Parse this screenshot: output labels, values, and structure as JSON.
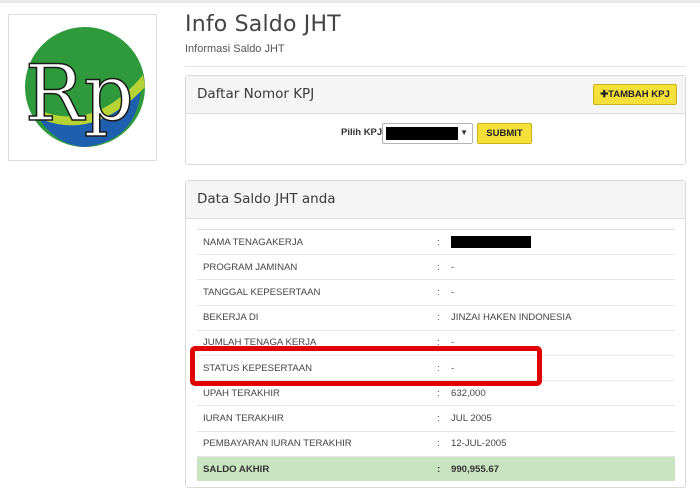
{
  "header": {
    "title": "Info Saldo JHT",
    "subtitle": "Informasi Saldo JHT"
  },
  "logo": {
    "text": "Rp",
    "icon": "rupiah-logo-icon",
    "colors": {
      "green": "#2e9a3c",
      "lime": "#b5d334",
      "blue": "#1f5fb0"
    }
  },
  "kpj_panel": {
    "title": "Daftar Nomor KPJ",
    "add_button": "✚TAMBAH KPJ",
    "select_label": "Pilih KPJ",
    "submit_button": "SUBMIT"
  },
  "saldo_panel": {
    "title": "Data Saldo JHT anda",
    "separator": ":",
    "rows": [
      {
        "label": "NAMA TENAGAKERJA",
        "value": ""
      },
      {
        "label": "PROGRAM JAMINAN",
        "value": "-"
      },
      {
        "label": "TANGGAL KEPESERTAAN",
        "value": "-"
      },
      {
        "label": "BEKERJA DI",
        "value": "JINZAI HAKEN INDONESIA"
      },
      {
        "label": "JUMLAH TENAGA KERJA",
        "value": "-"
      },
      {
        "label": "STATUS KEPESERTAAN",
        "value": "-"
      },
      {
        "label": "UPAH TERAKHIR",
        "value": "632,000"
      },
      {
        "label": "IURAN TERAKHIR",
        "value": "JUL 2005"
      },
      {
        "label": "PEMBAYARAN IURAN TERAKHIR",
        "value": "12-JUL-2005"
      },
      {
        "label": "SALDO AKHIR",
        "value": "990,955.67"
      }
    ]
  },
  "colors": {
    "accent_yellow": "#f5e03a",
    "total_row_green": "#c9e4c0",
    "highlight_red": "#e00000"
  }
}
